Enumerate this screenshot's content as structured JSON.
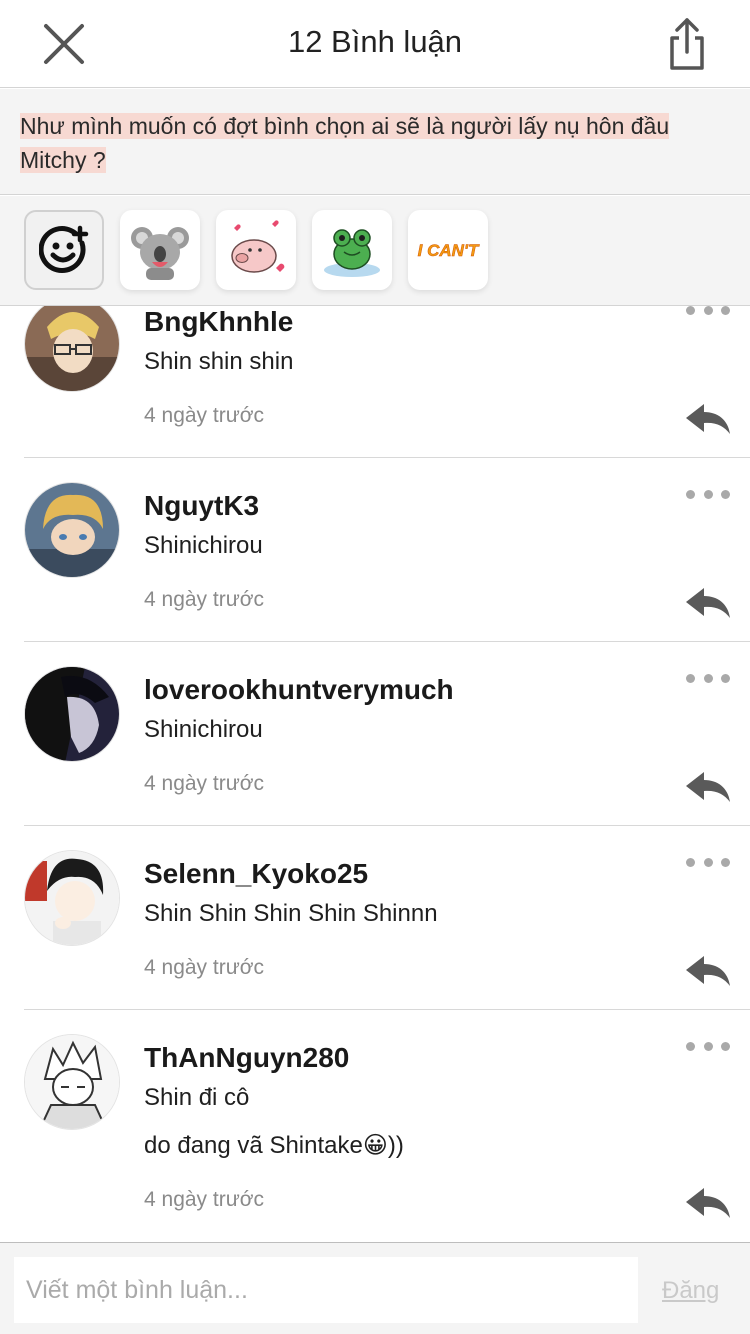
{
  "header": {
    "title": "12 Bình luận"
  },
  "post": {
    "excerpt": "Như mình muốn có đợt bình chọn ai sẽ là người  lấy nụ hôn đầu Mitchy ?"
  },
  "stickers": [
    {
      "name": "add-emoji-icon"
    },
    {
      "name": "koala-sticker"
    },
    {
      "name": "pig-hearts-sticker"
    },
    {
      "name": "frog-sticker"
    },
    {
      "name": "i-cant-sticker",
      "text": "I CAN'T"
    }
  ],
  "comments": [
    {
      "username": "BngKhnhle",
      "lines": [
        "Shin shin shin"
      ],
      "time": "4 ngày trước"
    },
    {
      "username": "NguytK3",
      "lines": [
        "Shinichirou"
      ],
      "time": "4 ngày trước"
    },
    {
      "username": "loverookhuntverymuch",
      "lines": [
        "Shinichirou"
      ],
      "time": "4 ngày trước"
    },
    {
      "username": "Selenn_Kyoko25",
      "lines": [
        "Shin Shin Shin Shin Shinnn"
      ],
      "time": "4 ngày trước"
    },
    {
      "username": "ThAnNguyn280",
      "lines": [
        "Shin đi cô",
        "do đang vã Shintake😀))"
      ],
      "time": "4 ngày trước"
    }
  ],
  "composer": {
    "placeholder": "Viết một bình luận...",
    "post_label": "Đăng"
  }
}
